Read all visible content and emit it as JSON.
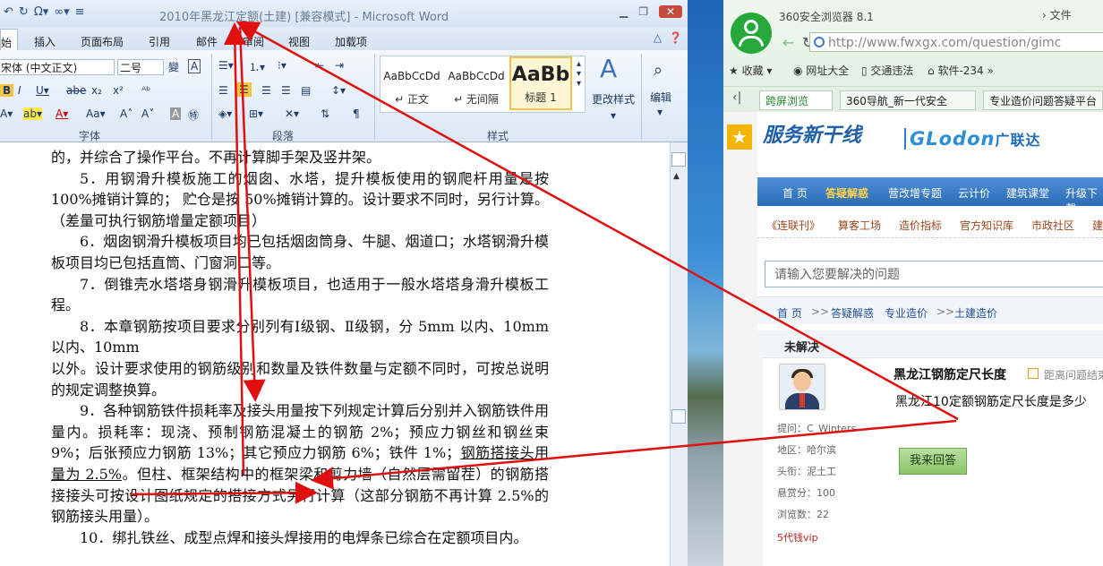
{
  "word": {
    "title": "2010年黑龙江定额(土建) [兼容模式] - Microsoft Word",
    "ribbon_tabs": [
      "始",
      "插入",
      "页面布局",
      "引用",
      "邮件",
      "审阅",
      "视图",
      "加载项"
    ],
    "font_name": "宋体 (中文正文)",
    "font_size": "二号",
    "styles": [
      {
        "preview": "AaBbCcDd",
        "name": "↵ 正文"
      },
      {
        "preview": "AaBbCcDd",
        "name": "↵ 无间隔"
      },
      {
        "preview": "AaBb",
        "name": "标题 1"
      }
    ],
    "change_styles": "更改样式",
    "edit": "编辑",
    "group_labels": {
      "font": "字体",
      "paragraph": "段落",
      "styles": "样式"
    },
    "paragraphs": [
      "的，并综合了操作平台。不再计算脚手架及竖井架。",
      "5．用钢滑升模板施工的烟囱、水塔，提升模板使用的钢爬杆用量是按 100%摊销计算的； 贮仓是按 50%摊销计算的。设计要求不同时，另行计算。（差量可执行钢筋增量定额项目）",
      "6．烟囱钢滑升模板项目均已包括烟囱筒身、牛腿、烟道口；水塔钢滑升模板项目均已包括直筒、门窗洞口等。",
      "7．倒锥壳水塔塔身钢滑升模板项目，也适用于一般水塔塔身滑升模板工程。",
      "8．本章钢筋按项目要求分别列有Ⅰ级钢、Ⅱ级钢，分 5mm 以内、10mm 以内、10mm",
      "以外。设计要求使用的钢筋级别和数量及铁件数量与定额不同时，可按总说明的规定调整换算。",
      "9．各种钢筋铁件损耗率及接头用量按下列规定计算后分别并入钢筋铁件用量内。损耗率：现浇、预制钢筋混凝土的钢筋 2%；预应力钢丝和钢丝束 9%；后张预应力钢筋 13%；其它预应力钢筋 6%；铁件 1%；",
      "钢筋搭接头用量为 2.5%",
      "。但柱、框架结构中的框架梁和剪力墙（自然层需留茬）的钢筋搭接接头可按设计图纸规定的搭接方式另行计算（这部分钢筋不再计算 2.5%的钢筋接头用量）。",
      "10．绑扎铁丝、成型点焊和接头焊接用的电焊条已综合在定额项目内。"
    ]
  },
  "browser": {
    "name": "360安全浏览器 8.1",
    "file_menu": "文件",
    "url": "http://www.fwxgx.com/question/gimc",
    "bookmarks": [
      "收藏",
      "网址大全",
      "交通违法",
      "软件-234"
    ],
    "tabs": [
      "跨屏浏览",
      "360导航_新一代安全",
      "专业造价问题答疑平台"
    ],
    "site": {
      "logo_left": "服务新干线",
      "logo_right_en": "GLodon",
      "logo_right_cn": "广联达",
      "main_nav": [
        "首 页",
        "答疑解惑",
        "营改增专题",
        "云计价",
        "建筑课堂",
        "升级下载"
      ],
      "sub_nav": [
        "《连联刊》",
        "算客工场",
        "造价指标",
        "官方知识库",
        "市政社区",
        "建"
      ],
      "search_placeholder": "请输入您要解决的问题",
      "breadcrumb": [
        "首 页",
        "答疑解惑",
        "专业造价",
        "土建造价"
      ],
      "status": "未解决",
      "question_title": "黑龙江钢筋定尺长度",
      "question_time": "距离问题结束",
      "question_body": "黑龙江10定额钢筋定尺长度是多少",
      "asker": "提问：C_Winters",
      "region": "地区：哈尔滨",
      "title_role": "头衔：泥土工",
      "reward": "悬赏分：100",
      "views": "浏览数：22",
      "vip": "5代钱vip",
      "answer_button": "我来回答"
    }
  }
}
